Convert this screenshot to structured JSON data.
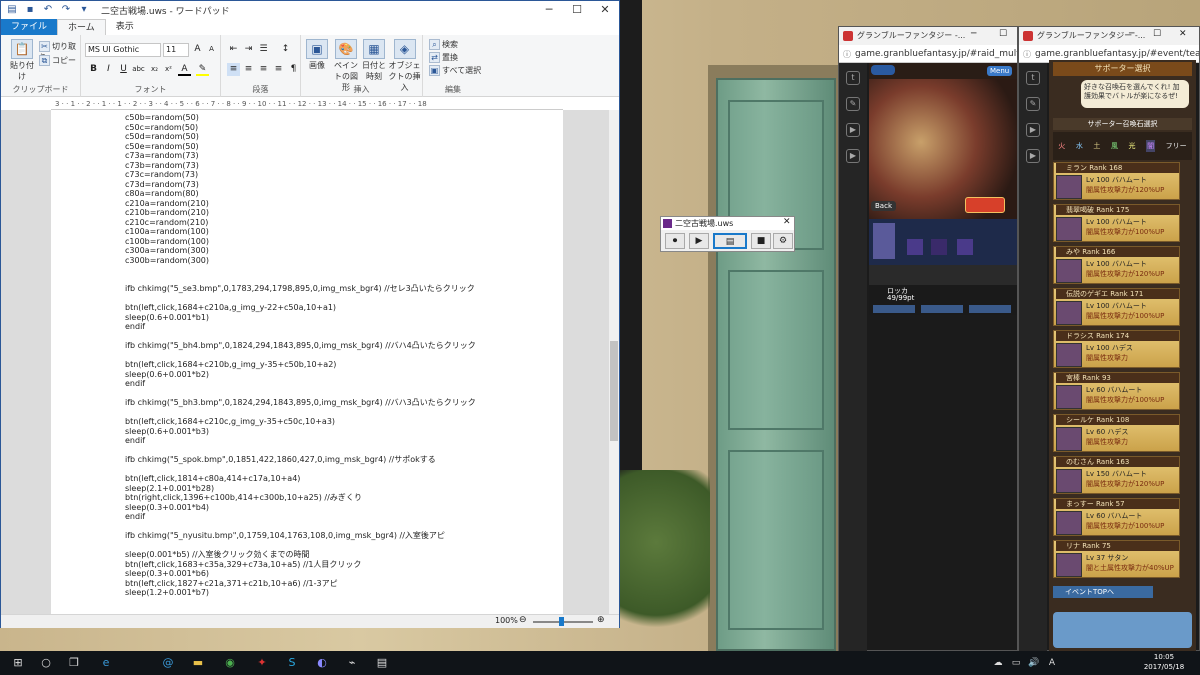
{
  "wordpad": {
    "title": "二空古戦場.uws - ワードパッド",
    "tabs": [
      "ファイル",
      "ホーム",
      "表示"
    ],
    "clipboard": {
      "paste": "貼り付け",
      "cut": "切り取り",
      "copy": "コピー",
      "label": "クリップボード"
    },
    "font": {
      "name": "MS UI Gothic",
      "size": "11",
      "label": "フォント"
    },
    "paragraph_label": "段落",
    "insert": {
      "picture": "画像",
      "paint": "ペイントの図形",
      "datetime": "日付と時刻",
      "object": "オブジェクトの挿入",
      "label": "挿入"
    },
    "edit": {
      "find": "検索",
      "replace": "置換",
      "select_all": "すべて選択",
      "label": "編集"
    },
    "ruler": "3 · · 1 · · 2 · · 1 · · 1 · · 2 · · 3 · · 4 · · 5 · · 6 · · 7 · · 8 · · 9 · · 10 · · 11 · · 12 · · 13 · · 14 · · 15 · · 16 · · 17 · · 18",
    "code": "c50b=random(50)\nc50c=random(50)\nc50d=random(50)\nc50e=random(50)\nc73a=random(73)\nc73b=random(73)\nc73c=random(73)\nc73d=random(73)\nc80a=random(80)\nc210a=random(210)\nc210b=random(210)\nc210c=random(210)\nc100a=random(100)\nc100b=random(100)\nc300a=random(300)\nc300b=random(300)\n\n\nifb chkimg(\"5_se3.bmp\",0,1783,294,1798,895,0,img_msk_bgr4) //セレ3凸いたらクリック\n\nbtn(left,click,1684+c210a,g_img_y-22+c50a,10+a1)\nsleep(0.6+0.001*b1)\nendif\n\nifb chkimg(\"5_bh4.bmp\",0,1824,294,1843,895,0,img_msk_bgr4) //バハ4凸いたらクリック\n\nbtn(left,click,1684+c210b,g_img_y-35+c50b,10+a2)\nsleep(0.6+0.001*b2)\nendif\n\nifb chkimg(\"5_bh3.bmp\",0,1824,294,1843,895,0,img_msk_bgr4) //バハ3凸いたらクリック\n\nbtn(left,click,1684+c210c,g_img_y-35+c50c,10+a3)\nsleep(0.6+0.001*b3)\nendif\n\nifb chkimg(\"5_spok.bmp\",0,1851,422,1860,427,0,img_msk_bgr4) //サポokする\n\nbtn(left,click,1814+c80a,414+c17a,10+a4)\nsleep(2.1+0.001*b28)\nbtn(right,click,1396+c100b,414+c300b,10+a25) //みぎくり\nsleep(0.3+0.001*b4)\nendif\n\nifb chkimg(\"5_nyusitu.bmp\",0,1759,104,1763,108,0,img_msk_bgr4) //入室後アピ\n\nsleep(0.001*b5) //入室後クリック効くまでの時間\nbtn(left,click,1683+c35a,329+c73a,10+a5) //1人目クリック\nsleep(0.3+0.001*b6)\nbtn(left,click,1827+c21a,371+c21b,10+a6) //1-3アピ\nsleep(1.2+0.001*b7)",
    "zoom": "100%"
  },
  "uws_dialog": {
    "title": "二空古戦場.uws"
  },
  "browser1": {
    "title": "グランブルーファンタジー -...",
    "url": "game.granbluefantasy.jp/#raid_multi/..."
  },
  "browser2": {
    "title": "グランブルーファンタジー -...",
    "url": "game.granbluefantasy.jp/#event/team"
  },
  "game1": {
    "menu": "Menu",
    "back": "Back",
    "boss": "ロッカ",
    "points": "49/99pt"
  },
  "game2": {
    "header": "サポーター選択",
    "tooltip": "好きな召喚石を選んでくれ! 加護効果でバトルが楽になるぜ!",
    "section": "サポーター召喚石選択",
    "elements": [
      "火",
      "水",
      "土",
      "風",
      "光",
      "闇",
      "フリー"
    ],
    "supporters": [
      {
        "name": "ミラン Rank 168",
        "summon": "Lv 100 バハムート",
        "effect": "闇属性攻撃力が120%UP"
      },
      {
        "name": "翡翠喝破 Rank 175",
        "summon": "Lv 100 バハムート",
        "effect": "闇属性攻撃力が100%UP"
      },
      {
        "name": "みや Rank 166",
        "summon": "Lv 100 バハムート",
        "effect": "闇属性攻撃力が120%UP"
      },
      {
        "name": "伝説のゲギエ Rank 171",
        "summon": "Lv 100 バハムート",
        "effect": "闇属性攻撃力が100%UP"
      },
      {
        "name": "ドラシス Rank 174",
        "summon": "Lv 100 ハデス",
        "effect": "闇属性攻撃力"
      },
      {
        "name": "宮棒 Rank 93",
        "summon": "Lv 60 バハムート",
        "effect": "闇属性攻撃力が100%UP"
      },
      {
        "name": "シールケ Rank 108",
        "summon": "Lv 60 ハデス",
        "effect": "闇属性攻撃力"
      },
      {
        "name": "のむさん Rank 163",
        "summon": "Lv 150 バハムート",
        "effect": "闇属性攻撃力が120%UP"
      },
      {
        "name": "まっすー Rank 57",
        "summon": "Lv 60 バハムート",
        "effect": "闇属性攻撃力が100%UP"
      },
      {
        "name": "リナ Rank 75",
        "summon": "Lv 37 サタン",
        "effect": "闇と土属性攻撃力が40%UP"
      }
    ],
    "event_top": "イベントTOPへ"
  },
  "taskbar": {
    "time": "10:05",
    "date": "2017/05/18"
  },
  "colors": {
    "accent": "#1979ca",
    "taskbar": "#101418"
  }
}
